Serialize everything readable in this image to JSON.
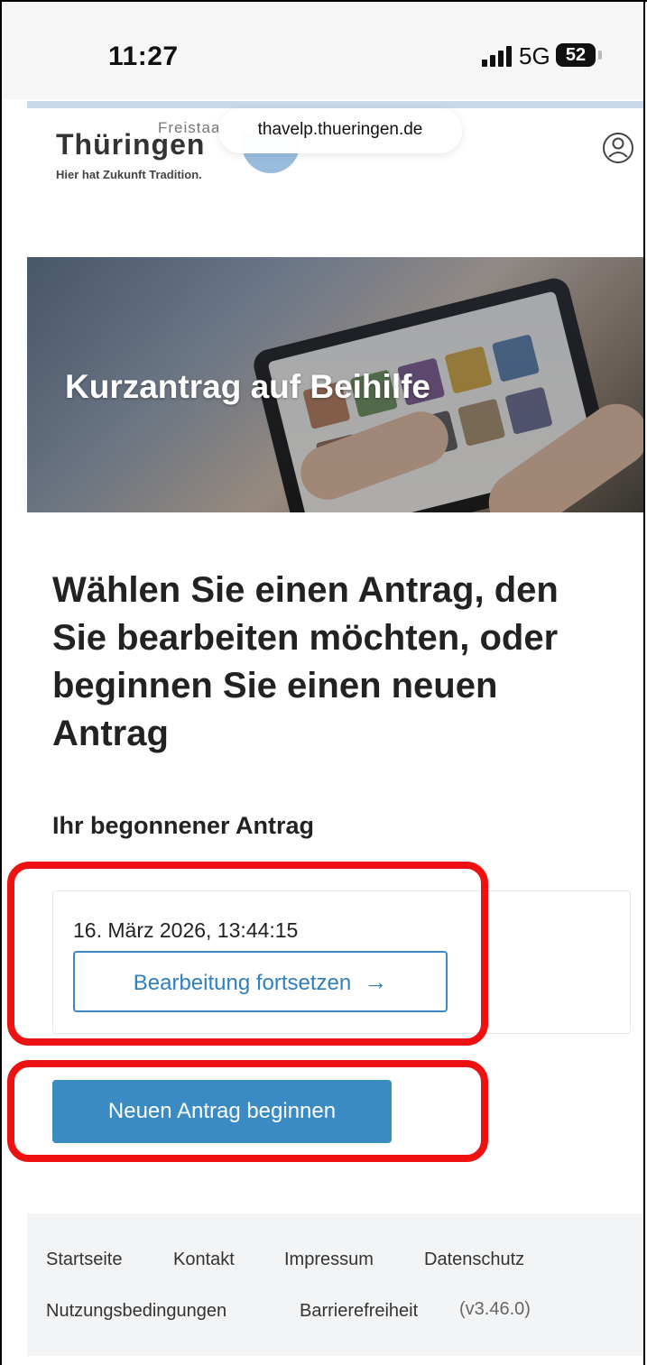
{
  "status_bar": {
    "time": "11:27",
    "network": "5G",
    "battery": "52"
  },
  "browser": {
    "url": "thavelp.thueringen.de"
  },
  "header": {
    "logo_top": "Freistaat",
    "logo_main": "Thüringen",
    "logo_tagline": "Hier hat Zukunft Tradition."
  },
  "hero": {
    "title": "Kurzantrag auf Beihilfe"
  },
  "main": {
    "heading": "Wählen Sie einen Antrag, den Sie bearbeiten möchten, oder beginnen Sie einen neuen Antrag",
    "draft_section_title": "Ihr begonnener Antrag",
    "draft": {
      "date": "16. März 2026, 13:44:15",
      "continue_label": "Bearbeitung fortsetzen",
      "continue_arrow": "→"
    },
    "new_button_label": "Neuen Antrag beginnen"
  },
  "footer": {
    "links": [
      "Startseite",
      "Kontakt",
      "Impressum",
      "Datenschutz",
      "Nutzungsbedingungen",
      "Barrierefreiheit"
    ],
    "version": "(v3.46.0)"
  },
  "colors": {
    "primary": "#3a8ac4",
    "outline_button": "#3e87c4",
    "highlight": "#ee1111"
  }
}
